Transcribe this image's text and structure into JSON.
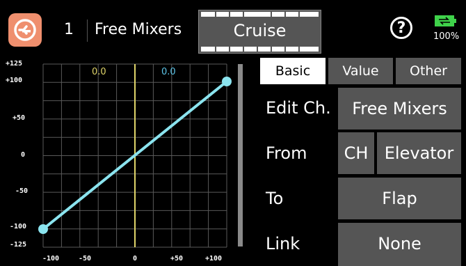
{
  "header": {
    "model_number": "1",
    "screen_title": "Free Mixers",
    "mode_label": "Cruise",
    "help_label": "?",
    "battery_percent": "100%",
    "battery_level": 1.0,
    "logo_icon": "model-icon",
    "accent_color": "#ef8f6e"
  },
  "graph": {
    "readout_left": "0.0",
    "readout_right": "0.0",
    "y_tick_labels": [
      "+125",
      "+100",
      "+50",
      "0",
      "-50",
      "-100",
      "-125"
    ],
    "x_tick_labels": [
      "-100",
      "-50",
      "0",
      "+50",
      "+100"
    ],
    "curve_points": [
      [
        -100,
        -100
      ],
      [
        100,
        100
      ]
    ],
    "curve_color": "#8be4ef",
    "center_line_color": "#e0d56a"
  },
  "tabs": [
    {
      "label": "Basic",
      "active": true
    },
    {
      "label": "Value",
      "active": false
    },
    {
      "label": "Other",
      "active": false
    }
  ],
  "fields": {
    "edit_ch": {
      "label": "Edit Ch.",
      "value": "Free Mixers"
    },
    "from": {
      "label": "From",
      "prefix": "CH",
      "value": "Elevator"
    },
    "to": {
      "label": "To",
      "value": "Flap"
    },
    "link": {
      "label": "Link",
      "value": "None"
    }
  }
}
